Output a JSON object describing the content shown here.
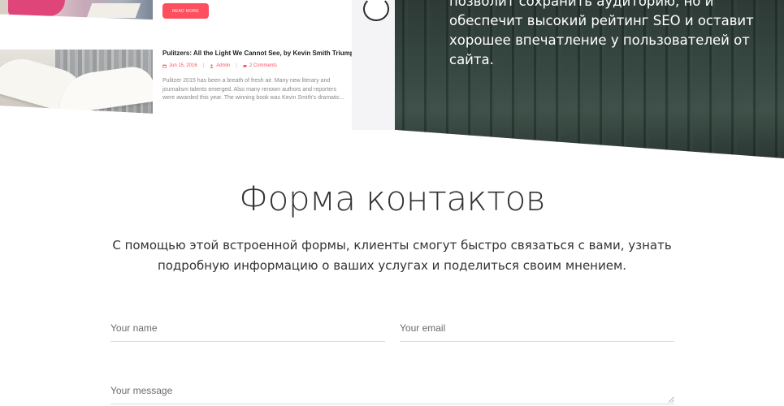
{
  "posts": [
    {
      "read_more_label": "READ MORE"
    },
    {
      "title": "Pulitzers: All the Light We Cannot See, by Kevin Smith Triumphs",
      "date": "Jun 15, 2016",
      "author": "Admin",
      "comments": "2 Comments",
      "excerpt": "Pulitzer 2015 has been a breath of fresh air. Many new literary and journalism talents emerged. Also many renown authors and reporters were awarded this year. The winning book was Kevin Smith's dramatic..."
    }
  ],
  "promo": {
    "lines": [
      "позволит сохранить аудиторию, но и",
      "обеспечит высокий рейтинг SEO и оставит",
      "хорошее впечатление у пользователей от",
      "сайта."
    ]
  },
  "contact": {
    "title": "Форма контактов",
    "description": "С помощью этой встроенной формы, клиенты смогут быстро связаться с вами, узнать подробную информацию о ваших услугах и поделиться своим мнением.",
    "name_placeholder": "Your name",
    "email_placeholder": "Your email",
    "message_placeholder": "Your message"
  },
  "icons": {
    "date": "calendar-icon",
    "author": "user-icon",
    "comments": "comment-icon",
    "loading": "spinner-icon",
    "resize": "resize-handle-icon"
  },
  "colors": {
    "accent": "#ff4f5e",
    "forest_overlay": "#33433d",
    "text_dark": "#333333",
    "field_border": "#dcdcdc"
  }
}
